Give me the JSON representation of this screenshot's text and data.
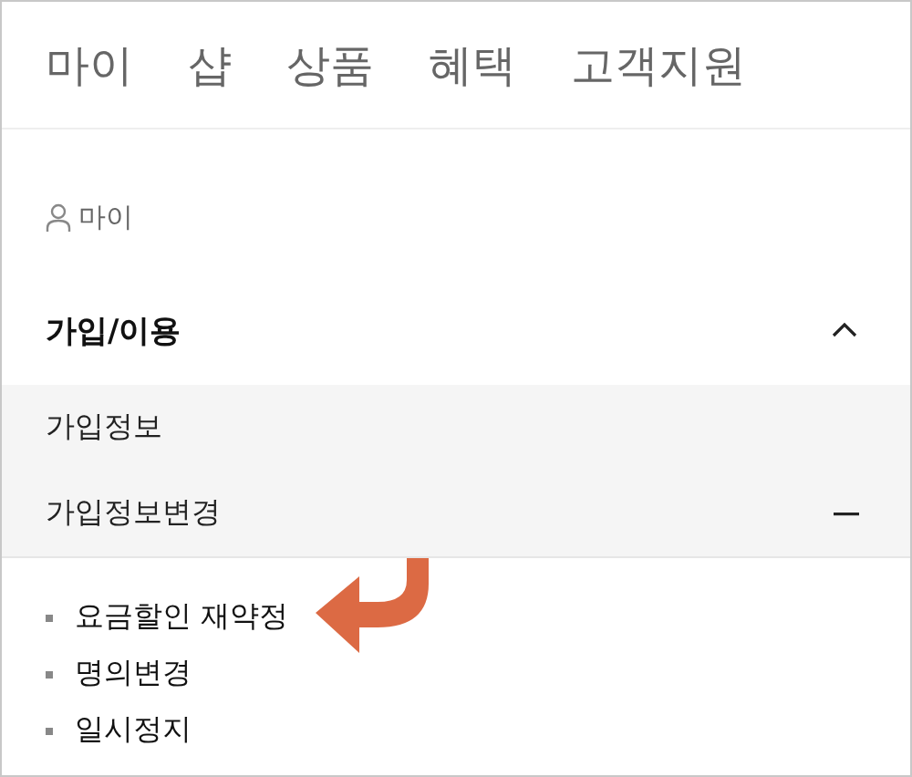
{
  "tabs": [
    {
      "label": "마이",
      "selected": false
    },
    {
      "label": "샵",
      "selected": false
    },
    {
      "label": "상품",
      "selected": false
    },
    {
      "label": "혜택",
      "selected": false
    },
    {
      "label": "고객지원",
      "selected": false
    }
  ],
  "breadcrumb": {
    "label": "마이"
  },
  "section": {
    "title": "가입/이용",
    "expanded": true,
    "items": [
      {
        "label": "가입정보",
        "kind": "link"
      },
      {
        "label": "가입정보변경",
        "kind": "group",
        "expanded": true,
        "children": [
          {
            "label": "요금할인 재약정",
            "annotated": true
          },
          {
            "label": "명의변경",
            "annotated": false
          },
          {
            "label": "일시정지",
            "annotated": false
          }
        ]
      }
    ]
  }
}
